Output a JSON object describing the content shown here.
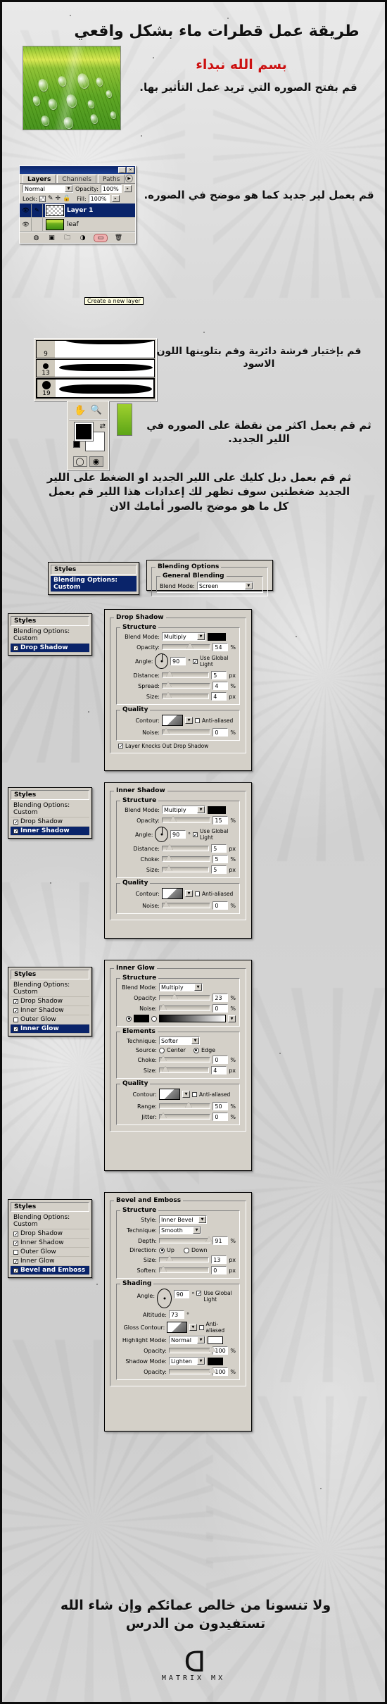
{
  "header": {
    "title_ar": "طريقة عمل قطرات ماء بشكل واقعي",
    "bismillah_ar": "بسم الله نبداء",
    "step1_ar": "قم بفتح الصوره التي تريد عمل التأثير بها."
  },
  "steps": {
    "step2_ar": "قم بعمل لير جديد كما هو موضح في الصوره.",
    "step3_ar": "قم بإختيار فرشة دائرية وقم بتلوينها اللون الاسود",
    "step4_ar": "ثم قم بعمل اكثر من نقطة على الصوره في اللير الجديد.",
    "step5_ar": "ثم قم بعمل دبل كليك على اللير الجديد او الضغط على اللير الجديد ضغطتين سوف تظهر لك إعدادات هذا اللير قم بعمل كل ما هو موضح بالصور أمامك الان",
    "footer_ar": "ولا تنسونا من خالص عمائكم وإن شاء الله تستفيدون من الدرس"
  },
  "logo": {
    "text": "MATRIX MX"
  },
  "layers_panel": {
    "tabs": [
      "Layers",
      "Channels",
      "Paths"
    ],
    "active_tab": "Layers",
    "blend_mode": "Normal",
    "opacity_label": "Opacity:",
    "opacity_value": "100%",
    "lock_label": "Lock:",
    "fill_label": "Fill:",
    "fill_value": "100%",
    "layers": [
      {
        "name": "Layer 1",
        "selected": true,
        "thumb": "checker"
      },
      {
        "name": "leaf",
        "selected": false,
        "thumb": "leaf"
      }
    ],
    "tooltip": "Create a new layer",
    "bottom_icons": [
      "fx-icon",
      "mask-icon",
      "folder-icon",
      "adjustment-icon",
      "new-layer-icon",
      "trash-icon"
    ],
    "title_buttons": [
      "minimize-icon",
      "close-icon"
    ]
  },
  "brush_panel": {
    "brushes": [
      {
        "size": "9"
      },
      {
        "size": "13"
      },
      {
        "size": "19"
      }
    ]
  },
  "tools_panel": {
    "tools": [
      "hand-icon",
      "zoom-icon"
    ],
    "foreground_color": "#000000",
    "background_color": "#ffffff",
    "modes": [
      "standard-mask-icon",
      "quick-mask-icon"
    ]
  },
  "blending_options": {
    "styles_header": "Styles",
    "selected_style": "Blending Options: Custom",
    "group_title": "Blending Options",
    "sub_group_title": "General Blending",
    "blend_mode_label": "Blend Mode:",
    "blend_mode_value": "Screen"
  },
  "dialogs": [
    {
      "id": "drop-shadow",
      "styles_header": "Styles",
      "styles_top_item": "Blending Options: Custom",
      "style_list": [
        {
          "label": "Drop Shadow",
          "checked": true,
          "active": true
        }
      ],
      "title": "Drop Shadow",
      "sections": [
        {
          "title": "Structure",
          "fields": [
            {
              "label": "Blend Mode:",
              "type": "select",
              "value": "Multiply",
              "swatch": "#000000"
            },
            {
              "label": "Opacity:",
              "type": "slider",
              "value": "54",
              "unit": "%",
              "pos": 54
            },
            {
              "label": "Angle:",
              "type": "dial",
              "value": "90",
              "unit": "°",
              "checkbox": "Use Global Light",
              "checked": true
            },
            {
              "label": "Distance:",
              "type": "slider",
              "value": "5",
              "unit": "px",
              "pos": 8
            },
            {
              "label": "Spread:",
              "type": "slider",
              "value": "4",
              "unit": "%",
              "pos": 5
            },
            {
              "label": "Size:",
              "type": "slider",
              "value": "4",
              "unit": "px",
              "pos": 5
            }
          ]
        },
        {
          "title": "Quality",
          "fields": [
            {
              "label": "Contour:",
              "type": "contour",
              "checkbox": "Anti-aliased",
              "checked": false
            },
            {
              "label": "Noise:",
              "type": "slider",
              "value": "0",
              "unit": "%",
              "pos": 0
            }
          ],
          "footer_checkbox": "Layer Knocks Out Drop Shadow",
          "footer_checked": true
        }
      ]
    },
    {
      "id": "inner-shadow",
      "styles_header": "Styles",
      "styles_top_item": "Blending Options: Custom",
      "style_list": [
        {
          "label": "Drop Shadow",
          "checked": true,
          "active": false
        },
        {
          "label": "Inner Shadow",
          "checked": true,
          "active": true
        }
      ],
      "title": "Inner Shadow",
      "sections": [
        {
          "title": "Structure",
          "fields": [
            {
              "label": "Blend Mode:",
              "type": "select",
              "value": "Multiply",
              "swatch": "#000000"
            },
            {
              "label": "Opacity:",
              "type": "slider",
              "value": "15",
              "unit": "%",
              "pos": 15
            },
            {
              "label": "Angle:",
              "type": "dial",
              "value": "90",
              "unit": "°",
              "checkbox": "Use Global Light",
              "checked": true
            },
            {
              "label": "Distance:",
              "type": "slider",
              "value": "5",
              "unit": "px",
              "pos": 8
            },
            {
              "label": "Choke:",
              "type": "slider",
              "value": "5",
              "unit": "%",
              "pos": 6
            },
            {
              "label": "Size:",
              "type": "slider",
              "value": "5",
              "unit": "px",
              "pos": 6
            }
          ]
        },
        {
          "title": "Quality",
          "fields": [
            {
              "label": "Contour:",
              "type": "contour",
              "checkbox": "Anti-aliased",
              "checked": false
            },
            {
              "label": "Noise:",
              "type": "slider",
              "value": "0",
              "unit": "%",
              "pos": 0
            }
          ]
        }
      ]
    },
    {
      "id": "inner-glow",
      "styles_header": "Styles",
      "styles_top_item": "Blending Options: Custom",
      "style_list": [
        {
          "label": "Drop Shadow",
          "checked": true,
          "active": false
        },
        {
          "label": "Inner Shadow",
          "checked": true,
          "active": false
        },
        {
          "label": "Outer Glow",
          "checked": false,
          "active": false
        },
        {
          "label": "Inner Glow",
          "checked": true,
          "active": true
        }
      ],
      "title": "Inner Glow",
      "sections": [
        {
          "title": "Structure",
          "fields": [
            {
              "label": "Blend Mode:",
              "type": "select",
              "value": "Multiply",
              "swatch": null
            },
            {
              "label": "Opacity:",
              "type": "slider",
              "value": "23",
              "unit": "%",
              "pos": 23
            },
            {
              "label": "Noise:",
              "type": "slider",
              "value": "0",
              "unit": "%",
              "pos": 0
            },
            {
              "label": "",
              "type": "gradient-radio",
              "value": "",
              "unit": ""
            }
          ]
        },
        {
          "title": "Elements",
          "fields": [
            {
              "label": "Technique:",
              "type": "select",
              "value": "Softer"
            },
            {
              "label": "Source:",
              "type": "radio2",
              "options": [
                "Center",
                "Edge"
              ],
              "selected": "Edge"
            },
            {
              "label": "Choke:",
              "type": "slider",
              "value": "0",
              "unit": "%",
              "pos": 0
            },
            {
              "label": "Size:",
              "type": "slider",
              "value": "4",
              "unit": "px",
              "pos": 5
            }
          ]
        },
        {
          "title": "Quality",
          "fields": [
            {
              "label": "Contour:",
              "type": "contour",
              "checkbox": "Anti-aliased",
              "checked": false
            },
            {
              "label": "Range:",
              "type": "slider",
              "value": "50",
              "unit": "%",
              "pos": 50
            },
            {
              "label": "Jitter:",
              "type": "slider",
              "value": "0",
              "unit": "%",
              "pos": 0
            }
          ]
        }
      ]
    },
    {
      "id": "bevel-emboss",
      "styles_header": "Styles",
      "styles_top_item": "Blending Options: Custom",
      "style_list": [
        {
          "label": "Drop Shadow",
          "checked": true,
          "active": false
        },
        {
          "label": "Inner Shadow",
          "checked": true,
          "active": false
        },
        {
          "label": "Outer Glow",
          "checked": false,
          "active": false
        },
        {
          "label": "Inner Glow",
          "checked": true,
          "active": false
        },
        {
          "label": "Bevel and Emboss",
          "checked": true,
          "active": true
        }
      ],
      "title": "Bevel and Emboss",
      "sections": [
        {
          "title": "Structure",
          "fields": [
            {
              "label": "Style:",
              "type": "select",
              "value": "Inner Bevel"
            },
            {
              "label": "Technique:",
              "type": "select",
              "value": "Smooth"
            },
            {
              "label": "Depth:",
              "type": "slider",
              "value": "91",
              "unit": "%",
              "pos": 91
            },
            {
              "label": "Direction:",
              "type": "radio2",
              "options": [
                "Up",
                "Down"
              ],
              "selected": "Up"
            },
            {
              "label": "Size:",
              "type": "slider",
              "value": "13",
              "unit": "px",
              "pos": 13
            },
            {
              "label": "Soften:",
              "type": "slider",
              "value": "0",
              "unit": "px",
              "pos": 0
            }
          ]
        },
        {
          "title": "Shading",
          "fields": [
            {
              "label": "Angle:",
              "type": "dial",
              "value": "90",
              "unit": "°",
              "checkbox": "Use Global Light",
              "checked": true
            },
            {
              "label": "Altitude:",
              "type": "value",
              "value": "73",
              "unit": "°"
            },
            {
              "label": "Gloss Contour:",
              "type": "contour",
              "checkbox": "Anti-aliased",
              "checked": false
            },
            {
              "label": "Highlight Mode:",
              "type": "select",
              "value": "Normal",
              "swatch": "#ffffff"
            },
            {
              "label": "Opacity:",
              "type": "slider",
              "value": "100",
              "unit": "%",
              "pos": 100
            },
            {
              "label": "Shadow Mode:",
              "type": "select",
              "value": "Lighten",
              "swatch": "#000000"
            },
            {
              "label": "Opacity:",
              "type": "slider",
              "value": "100",
              "unit": "%",
              "pos": 100
            }
          ]
        }
      ]
    }
  ]
}
